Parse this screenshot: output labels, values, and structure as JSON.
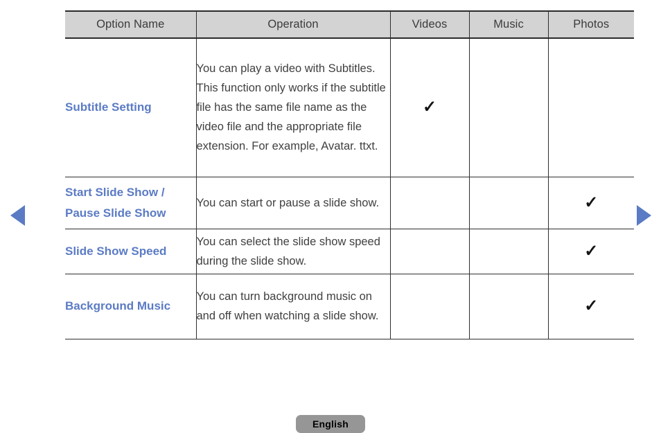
{
  "nav": {
    "prev_label": "previous-page",
    "next_label": "next-page",
    "arrow_color": "#5b7bc4"
  },
  "table": {
    "headers": [
      "Option Name",
      "Operation",
      "Videos",
      "Music",
      "Photos"
    ],
    "header_bg": "#d3d3d3",
    "option_name_color": "#5b7bc4",
    "check_glyph": "✓",
    "rows": [
      {
        "option_name": "Subtitle Setting",
        "operation": "You can play a video with Subtitles. This function only works if the subtitle file has the same file name as the video file and the appropriate file extension. For example, Avatar. ttxt.",
        "videos": "✓",
        "music": "",
        "photos": ""
      },
      {
        "option_name": "Start Slide Show / Pause Slide Show",
        "operation": "You can start or pause a slide show.",
        "videos": "",
        "music": "",
        "photos": "✓"
      },
      {
        "option_name": "Slide Show Speed",
        "operation": "You can select the slide show speed during the slide show.",
        "videos": "",
        "music": "",
        "photos": "✓"
      },
      {
        "option_name": "Background Music",
        "operation": "You can turn background music on and off when watching a slide show.",
        "videos": "",
        "music": "",
        "photos": "✓"
      }
    ]
  },
  "footer": {
    "language_label": "English",
    "button_bg": "#969696"
  }
}
